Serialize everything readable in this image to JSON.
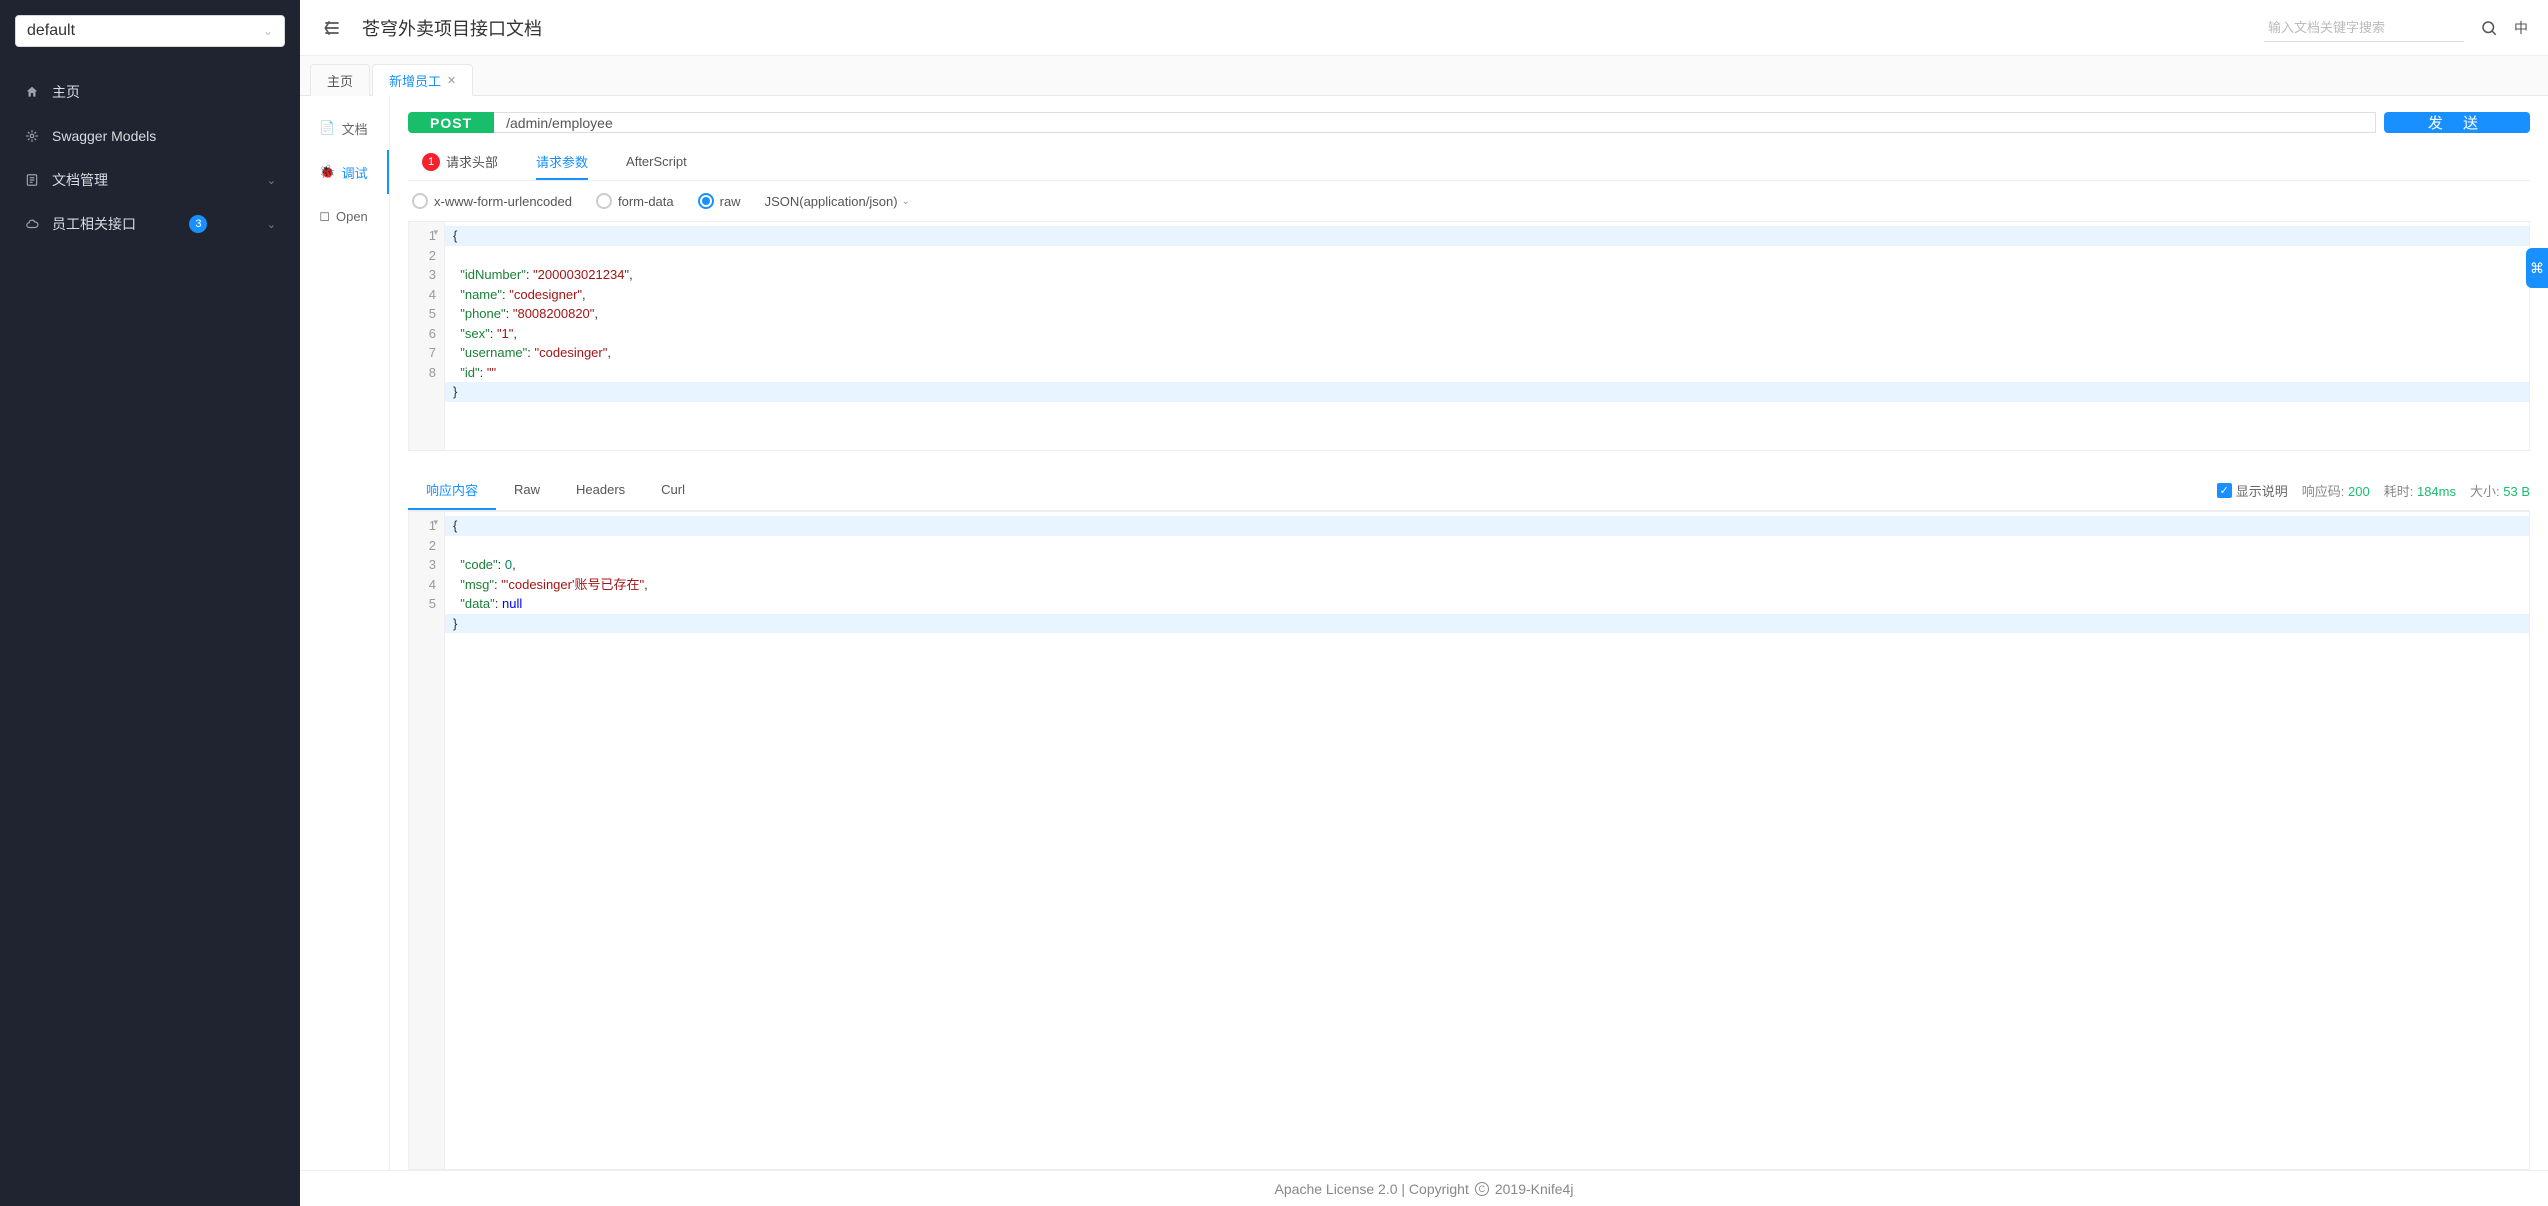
{
  "sidebar": {
    "selector_value": "default",
    "items": [
      {
        "label": "主页",
        "icon": "home"
      },
      {
        "label": "Swagger Models",
        "icon": "models"
      },
      {
        "label": "文档管理",
        "icon": "doc-manage",
        "expandable": true
      },
      {
        "label": "员工相关接口",
        "icon": "cloud",
        "badge": "3",
        "expandable": true
      }
    ]
  },
  "header": {
    "title": "苍穹外卖项目接口文档",
    "search_placeholder": "输入文档关键字搜索",
    "lang": "中"
  },
  "doc_tabs": [
    {
      "label": "主页",
      "closable": false,
      "active": false
    },
    {
      "label": "新增员工",
      "closable": true,
      "active": true
    }
  ],
  "left_rail": [
    {
      "label": "文档",
      "icon": "doc",
      "active": false
    },
    {
      "label": "调试",
      "icon": "bug",
      "active": true
    },
    {
      "label": "Open",
      "icon": "open",
      "active": false
    }
  ],
  "request": {
    "method": "POST",
    "url": "/admin/employee",
    "send_label": "发 送",
    "tabs": [
      {
        "label": "请求头部",
        "badge": "1",
        "active": false
      },
      {
        "label": "请求参数",
        "active": true
      },
      {
        "label": "AfterScript",
        "active": false
      }
    ],
    "body_types": [
      {
        "label": "x-www-form-urlencoded",
        "checked": false
      },
      {
        "label": "form-data",
        "checked": false
      },
      {
        "label": "raw",
        "checked": true
      }
    ],
    "content_type": "JSON(application/json)",
    "body_lines": [
      "{",
      "  \"idNumber\": \"200003021234\",",
      "  \"name\": \"codesigner\",",
      "  \"phone\": \"8008200820\",",
      "  \"sex\": \"1\",",
      "  \"username\": \"codesinger\",",
      "  \"id\":\"\"",
      "}"
    ]
  },
  "response": {
    "tabs": [
      {
        "label": "响应内容",
        "active": true
      },
      {
        "label": "Raw"
      },
      {
        "label": "Headers"
      },
      {
        "label": "Curl"
      }
    ],
    "show_desc_label": "显示说明",
    "status_label": "响应码:",
    "status_value": "200",
    "time_label": "耗时:",
    "time_value": "184ms",
    "size_label": "大小:",
    "size_value": "53 B",
    "body_lines": [
      "{",
      "  \"code\": 0,",
      "  \"msg\": \"'codesinger'账号已存在\",",
      "  \"data\": null",
      "}"
    ]
  },
  "footer": {
    "text_left": "Apache License 2.0 | Copyright",
    "text_right": "2019-Knife4j"
  }
}
